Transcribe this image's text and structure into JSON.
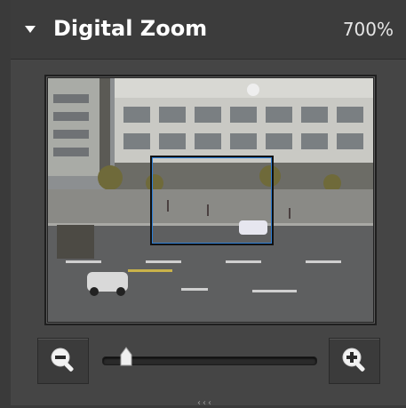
{
  "panel": {
    "title": "Digital Zoom",
    "zoom_level": "700%",
    "icons": {
      "collapse": "triangle-down-icon",
      "zoom_out": "zoom-out-icon",
      "zoom_in": "zoom-in-icon"
    }
  },
  "viewer": {
    "image": "cctv-street-scene",
    "roi_color": "#2d7fd6"
  },
  "slider": {
    "value_fraction": 0.08
  },
  "colors": {
    "accent": "#2d7fd6",
    "background": "#454545",
    "header": "#3c3c3c"
  }
}
